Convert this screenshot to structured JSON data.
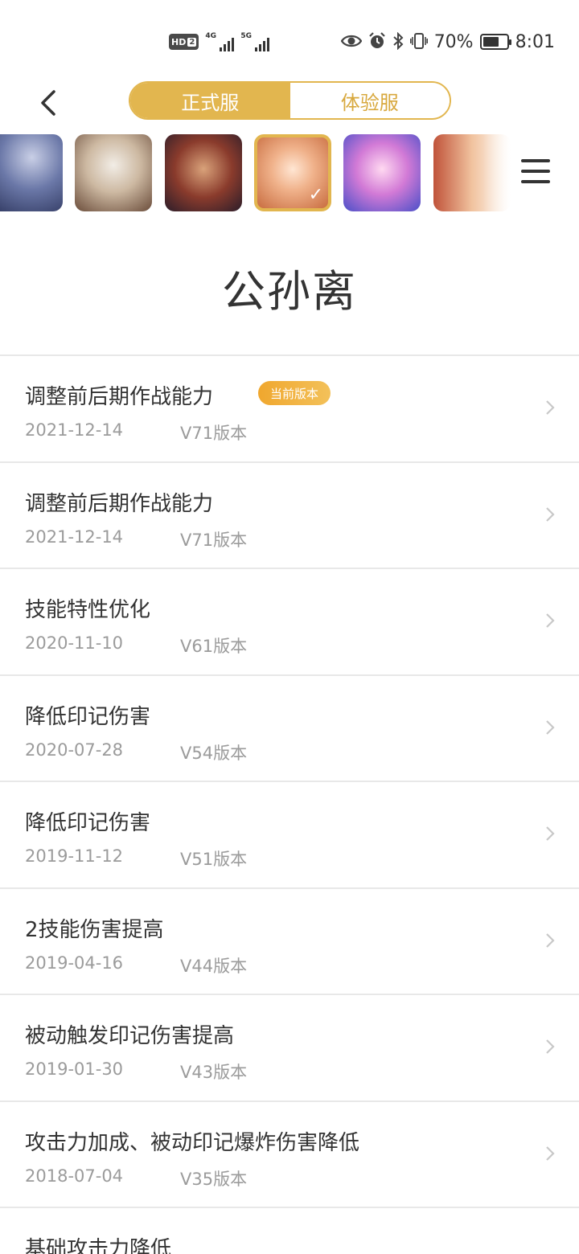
{
  "status": {
    "left_badge": "HD",
    "left_badge_num": "2",
    "net1": "4G",
    "net2": "5G",
    "battery_percent": "70%",
    "battery_level": 0.7,
    "time": "8:01",
    "icons": [
      "eye-icon",
      "alarm-icon",
      "bluetooth-icon",
      "vibrate-icon",
      "battery-icon"
    ]
  },
  "header": {
    "back_icon": "chevron-left-icon",
    "tabs": [
      {
        "label": "正式服",
        "active": true
      },
      {
        "label": "体验服",
        "active": false
      }
    ]
  },
  "heroes": {
    "count_visible": 6,
    "selected_index": 3,
    "menu_icon": "hamburger-menu-icon"
  },
  "hero_name": "公孙离",
  "current_badge": "当前版本",
  "accent_color": "#e2b64f",
  "entries": [
    {
      "title": "调整前后期作战能力",
      "date": "2021-12-14",
      "version": "V71版本",
      "current": true
    },
    {
      "title": "调整前后期作战能力",
      "date": "2021-12-14",
      "version": "V71版本",
      "current": false
    },
    {
      "title": "技能特性优化",
      "date": "2020-11-10",
      "version": "V61版本",
      "current": false
    },
    {
      "title": "降低印记伤害",
      "date": "2020-07-28",
      "version": "V54版本",
      "current": false
    },
    {
      "title": "降低印记伤害",
      "date": "2019-11-12",
      "version": "V51版本",
      "current": false
    },
    {
      "title": "2技能伤害提高",
      "date": "2019-04-16",
      "version": "V44版本",
      "current": false
    },
    {
      "title": "被动触发印记伤害提高",
      "date": "2019-01-30",
      "version": "V43版本",
      "current": false
    },
    {
      "title": "攻击力加成、被动印记爆炸伤害降低",
      "date": "2018-07-04",
      "version": "V35版本",
      "current": false
    },
    {
      "title": "基础攻击力降低",
      "date": "",
      "version": "",
      "current": false
    }
  ]
}
